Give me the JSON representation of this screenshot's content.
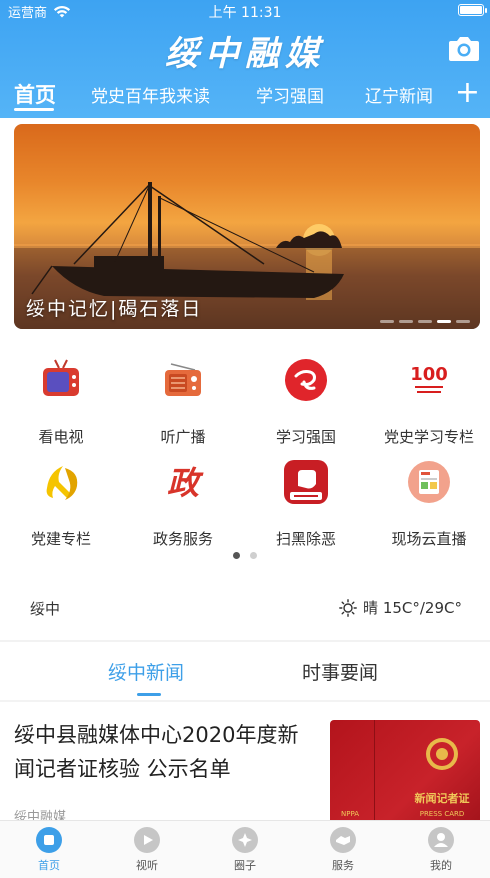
{
  "status_bar": {
    "carrier": "运营商",
    "time": "上午 11:31"
  },
  "header": {
    "app_title": "绥中融媒"
  },
  "tabs": [
    {
      "label": "首页"
    },
    {
      "label": "党史百年我来读"
    },
    {
      "label": "学习强国"
    },
    {
      "label": "辽宁新闻"
    }
  ],
  "banner": {
    "caption": "绥中记忆|碣石落日"
  },
  "grid": [
    {
      "label": "看电视",
      "icon": "tv-icon"
    },
    {
      "label": "听广播",
      "icon": "radio-icon"
    },
    {
      "label": "学习强国",
      "icon": "xuexi-icon"
    },
    {
      "label": "党史学习专栏",
      "icon": "party-history-icon"
    },
    {
      "label": "党建专栏",
      "icon": "party-emblem-icon"
    },
    {
      "label": "政务服务",
      "icon": "government-icon"
    },
    {
      "label": "扫黑除恶",
      "icon": "anti-crime-icon"
    },
    {
      "label": "现场云直播",
      "icon": "live-news-icon"
    }
  ],
  "weather": {
    "location": "绥中",
    "text": "晴 15C°/29C°"
  },
  "news_tabs": [
    {
      "label": "绥中新闻"
    },
    {
      "label": "时事要闻"
    }
  ],
  "news": [
    {
      "title": "绥中县融媒体中心2020年度新闻记者证核验 公示名单",
      "source": "绥中融媒",
      "thumb": {
        "label1": "新闻记者证",
        "label2": "PRESS CARD",
        "label3": "NPPA"
      }
    }
  ],
  "bottom_nav": [
    {
      "label": "首页"
    },
    {
      "label": "视听"
    },
    {
      "label": "圈子"
    },
    {
      "label": "服务"
    },
    {
      "label": "我的"
    }
  ],
  "colors": {
    "accent": "#3d9fe8",
    "header": "#4aaef5"
  }
}
